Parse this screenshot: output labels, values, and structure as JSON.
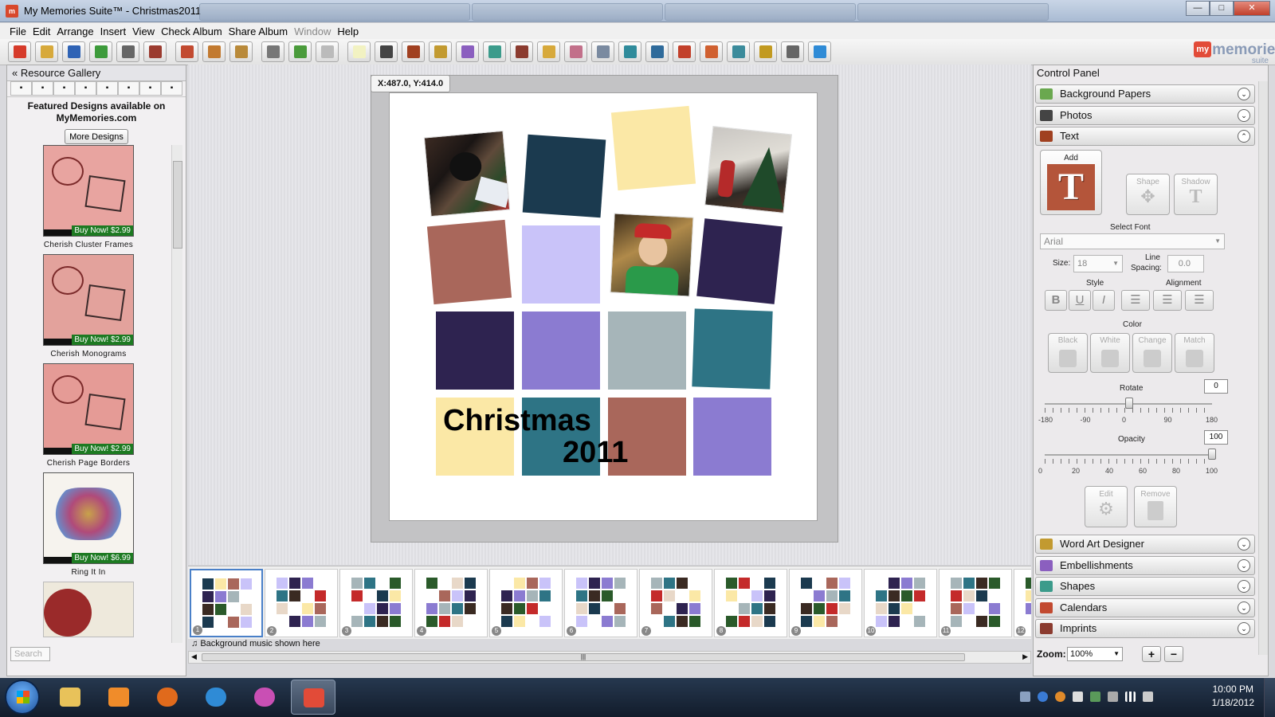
{
  "window": {
    "title": "My Memories Suite™ - Christmas2011",
    "controls": [
      "—",
      "□",
      "✕"
    ]
  },
  "menu": [
    {
      "label": "File",
      "enabled": true
    },
    {
      "label": "Edit",
      "enabled": true
    },
    {
      "label": "Arrange",
      "enabled": true
    },
    {
      "label": "Insert",
      "enabled": true
    },
    {
      "label": "View",
      "enabled": true
    },
    {
      "label": "Check Album",
      "enabled": true
    },
    {
      "label": "Share Album",
      "enabled": true
    },
    {
      "label": "Window",
      "enabled": false
    },
    {
      "label": "Help",
      "enabled": true
    }
  ],
  "toolbar_icons": [
    {
      "name": "new-album-icon",
      "color": "#d63b2a"
    },
    {
      "name": "open-icon",
      "color": "#d7a93b"
    },
    {
      "name": "save-icon",
      "color": "#2f63b5"
    },
    {
      "name": "save-as-icon",
      "color": "#3d9b3b"
    },
    {
      "name": "print-icon",
      "color": "#666666"
    },
    {
      "name": "cut-icon",
      "color": "#9b3b2f"
    },
    {
      "name": "copy-icon",
      "color": "#c24a30"
    },
    {
      "name": "paste-icon",
      "color": "#c27a30"
    },
    {
      "name": "clipboard-icon",
      "color": "#b98a3a"
    },
    {
      "name": "tools-icon",
      "color": "#777777"
    },
    {
      "name": "undo-icon",
      "color": "#4a9b3b"
    },
    {
      "name": "redo-icon",
      "color": "#bbbbbb"
    },
    {
      "name": "add-page-icon",
      "color": "#f2f2c2"
    },
    {
      "name": "camera-icon",
      "color": "#444444"
    },
    {
      "name": "text-icon",
      "color": "#a04020"
    },
    {
      "name": "word-art-icon",
      "color": "#c29a30"
    },
    {
      "name": "embellishment-icon",
      "color": "#8b5fbf"
    },
    {
      "name": "shapes-icon",
      "color": "#3b9b8b"
    },
    {
      "name": "film-icon",
      "color": "#8b3b2f"
    },
    {
      "name": "journal-icon",
      "color": "#d7a93b"
    },
    {
      "name": "hand-icon",
      "color": "#c2708a"
    },
    {
      "name": "music-icon",
      "color": "#7a8aa0"
    },
    {
      "name": "export-icon",
      "color": "#2f8b9b"
    },
    {
      "name": "publish-icon",
      "color": "#2f6b9b"
    },
    {
      "name": "layout-icon",
      "color": "#c2402a"
    },
    {
      "name": "stamp-icon",
      "color": "#d06030"
    },
    {
      "name": "grid-icon",
      "color": "#3b8b9b"
    },
    {
      "name": "dvd-icon",
      "color": "#c29a20"
    },
    {
      "name": "cart-icon",
      "color": "#666666"
    },
    {
      "name": "help-icon",
      "color": "#2f8bd6"
    }
  ],
  "logo": {
    "badge": "my",
    "word": "memories",
    "sub": "suite"
  },
  "resource_gallery": {
    "title": "Resource Gallery",
    "tabs": [
      "cart-icon",
      "camera-icon",
      "embellishment-icon",
      "shapes-icon",
      "film-icon",
      "layout-icon",
      "paper-icon",
      "word-art-icon"
    ],
    "featured_line1": "Featured Designs available on",
    "featured_line2": "MyMemories.com",
    "more_button": "More Designs",
    "items": [
      {
        "label": "Cherish Cluster Frames",
        "buy": "Buy Now! $2.99",
        "bg": "#e8a4a0"
      },
      {
        "label": "Cherish Monograms",
        "buy": "Buy Now! $2.99",
        "bg": "#e3a29c"
      },
      {
        "label": "Cherish Page Borders",
        "buy": "Buy Now! $2.99",
        "bg": "#e59b96"
      },
      {
        "label": "Ring It In",
        "buy": "Buy Now! $6.99",
        "bg": "#f6f3ee"
      },
      {
        "label": "",
        "buy": "",
        "bg": "#eee9dc"
      }
    ],
    "search_placeholder": "Search"
  },
  "canvas": {
    "coords": "X:487.0, Y:414.0",
    "title_line1": "Christmas",
    "title_line2": "2011",
    "colors": {
      "navy": "#1b3a4f",
      "cream": "#fbe8a6",
      "rose": "#a9675b",
      "lavender": "#c9c3f9",
      "plum": "#2e2350",
      "violet": "#8b7bd1",
      "gray": "#a6b5b9",
      "teal": "#2e7485"
    }
  },
  "filmstrip": {
    "pages": [
      "1",
      "2",
      "3",
      "4",
      "5",
      "6",
      "7",
      "8",
      "9",
      "10",
      "11",
      "12"
    ],
    "music_text": "Background music shown here"
  },
  "control_panel": {
    "title": "Control Panel",
    "sections_top": [
      {
        "label": "Background Papers",
        "icon": "paper-icon",
        "color": "#6aa84f"
      },
      {
        "label": "Photos",
        "icon": "camera-icon",
        "color": "#444444"
      },
      {
        "label": "Text",
        "icon": "text-icon",
        "color": "#a04020"
      }
    ],
    "text": {
      "add_label": "Add",
      "shape_label": "Shape",
      "shadow_label": "Shadow",
      "select_font_label": "Select Font",
      "font_value": "Arial",
      "size_label": "Size:",
      "size_value": "18",
      "line_spacing_label1": "Line",
      "line_spacing_label2": "Spacing:",
      "line_spacing_value": "0.0",
      "style_label": "Style",
      "alignment_label": "Alignment",
      "style_buttons": [
        "B",
        "U",
        "I"
      ],
      "color_label": "Color",
      "color_buttons": [
        "Black",
        "White",
        "Change",
        "Match"
      ],
      "rotate_label": "Rotate",
      "rotate_value": "0",
      "rotate_ticks": [
        "-180",
        "-90",
        "0",
        "90",
        "180"
      ],
      "opacity_label": "Opacity",
      "opacity_value": "100",
      "opacity_ticks": [
        "0",
        "20",
        "40",
        "60",
        "80",
        "100"
      ],
      "edit_label": "Edit",
      "remove_label": "Remove"
    },
    "sections_bottom": [
      {
        "label": "Word Art Designer",
        "icon": "word-art-icon",
        "color": "#c29a30"
      },
      {
        "label": "Embellishments",
        "icon": "embellishment-icon",
        "color": "#8b5fbf"
      },
      {
        "label": "Shapes",
        "icon": "shapes-icon",
        "color": "#3b9b8b"
      },
      {
        "label": "Calendars",
        "icon": "calendar-icon",
        "color": "#c24a30"
      },
      {
        "label": "Imprints",
        "icon": "imprint-icon",
        "color": "#8b3b2f"
      }
    ],
    "zoom_label": "Zoom:",
    "zoom_value": "100%"
  },
  "taskbar": {
    "apps": [
      {
        "name": "explorer-icon",
        "color": "#e8c25a"
      },
      {
        "name": "media-player-icon",
        "color": "#f08c2a"
      },
      {
        "name": "firefox-icon",
        "color": "#e06a1c"
      },
      {
        "name": "internet-explorer-icon",
        "color": "#2f8bd6"
      },
      {
        "name": "picasa-icon",
        "color": "#c94fb4"
      },
      {
        "name": "my-memories-icon",
        "color": "#e24b38"
      }
    ],
    "time": "10:00 PM",
    "date": "1/18/2012"
  }
}
